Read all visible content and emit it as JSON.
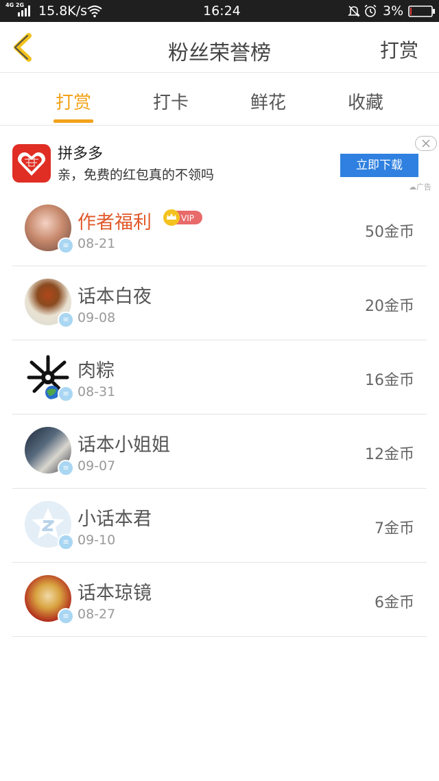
{
  "status_bar": {
    "network": "4G 2G",
    "speed": "15.8K/s",
    "time": "16:24",
    "battery": "3%",
    "battery_color": "#e53935",
    "icons": [
      "signal-icon",
      "wifi-icon",
      "mute-icon",
      "alarm-icon",
      "battery-icon"
    ]
  },
  "header": {
    "title": "粉丝荣誉榜",
    "action": "打赏",
    "back_icon": "chevron-left-icon",
    "accent_color": "#f2a31b"
  },
  "tabs": [
    {
      "label": "打赏",
      "active": true
    },
    {
      "label": "打卡",
      "active": false
    },
    {
      "label": "鲜花",
      "active": false
    },
    {
      "label": "收藏",
      "active": false
    }
  ],
  "ad": {
    "name": "拼多多",
    "description": "亲，免费的红包真的不领吗",
    "button": "立即下载",
    "label": "广告",
    "button_color": "#2f80e0"
  },
  "list": [
    {
      "name": "作者福利",
      "date": "08-21",
      "amount": "50金币",
      "vip": true,
      "vip_label": "VIP",
      "highlight": true
    },
    {
      "name": "话本白夜",
      "date": "09-08",
      "amount": "20金币",
      "vip": false,
      "highlight": false
    },
    {
      "name": "肉粽",
      "date": "08-31",
      "amount": "16金币",
      "vip": false,
      "highlight": false
    },
    {
      "name": "话本小姐姐",
      "date": "09-07",
      "amount": "12金币",
      "vip": false,
      "highlight": false
    },
    {
      "name": "小话本君",
      "date": "09-10",
      "amount": "7金币",
      "vip": false,
      "highlight": false
    },
    {
      "name": "话本琼镜",
      "date": "08-27",
      "amount": "6金币",
      "vip": false,
      "highlight": false
    }
  ]
}
